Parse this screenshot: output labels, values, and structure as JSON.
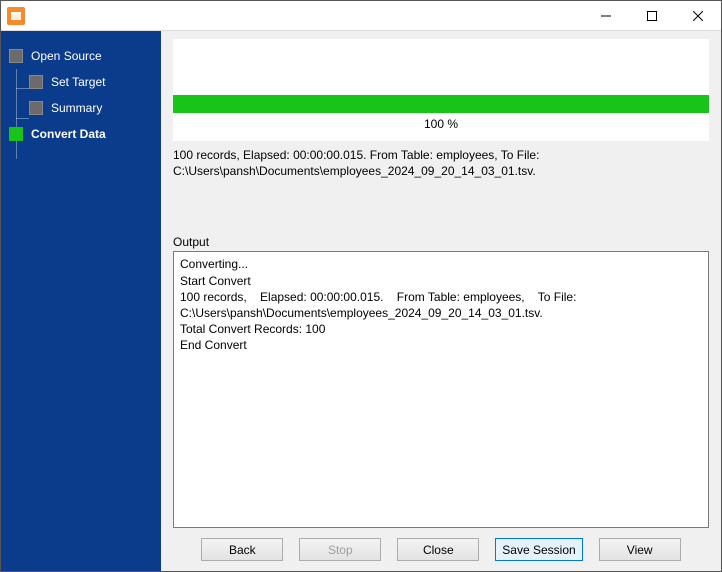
{
  "window": {
    "title": ""
  },
  "sidebar": {
    "items": [
      {
        "label": "Open Source",
        "active": false,
        "child": false
      },
      {
        "label": "Set Target",
        "active": false,
        "child": true
      },
      {
        "label": "Summary",
        "active": false,
        "child": true
      },
      {
        "label": "Convert Data",
        "active": true,
        "child": false
      }
    ]
  },
  "progress": {
    "percent_label": "100 %",
    "summary_line1": "100 records,    Elapsed: 00:00:00.015.    From Table: employees,    To File:",
    "summary_line2": "C:\\Users\\pansh\\Documents\\employees_2024_09_20_14_03_01.tsv."
  },
  "output": {
    "label": "Output",
    "lines": [
      "Converting...",
      "Start Convert",
      "100 records,    Elapsed: 00:00:00.015.    From Table: employees,    To File: C:\\Users\\pansh\\Documents\\employees_2024_09_20_14_03_01.tsv.",
      "Total Convert Records: 100",
      "End Convert"
    ]
  },
  "buttons": {
    "back": "Back",
    "stop": "Stop",
    "close": "Close",
    "save_session": "Save Session",
    "view": "View"
  }
}
